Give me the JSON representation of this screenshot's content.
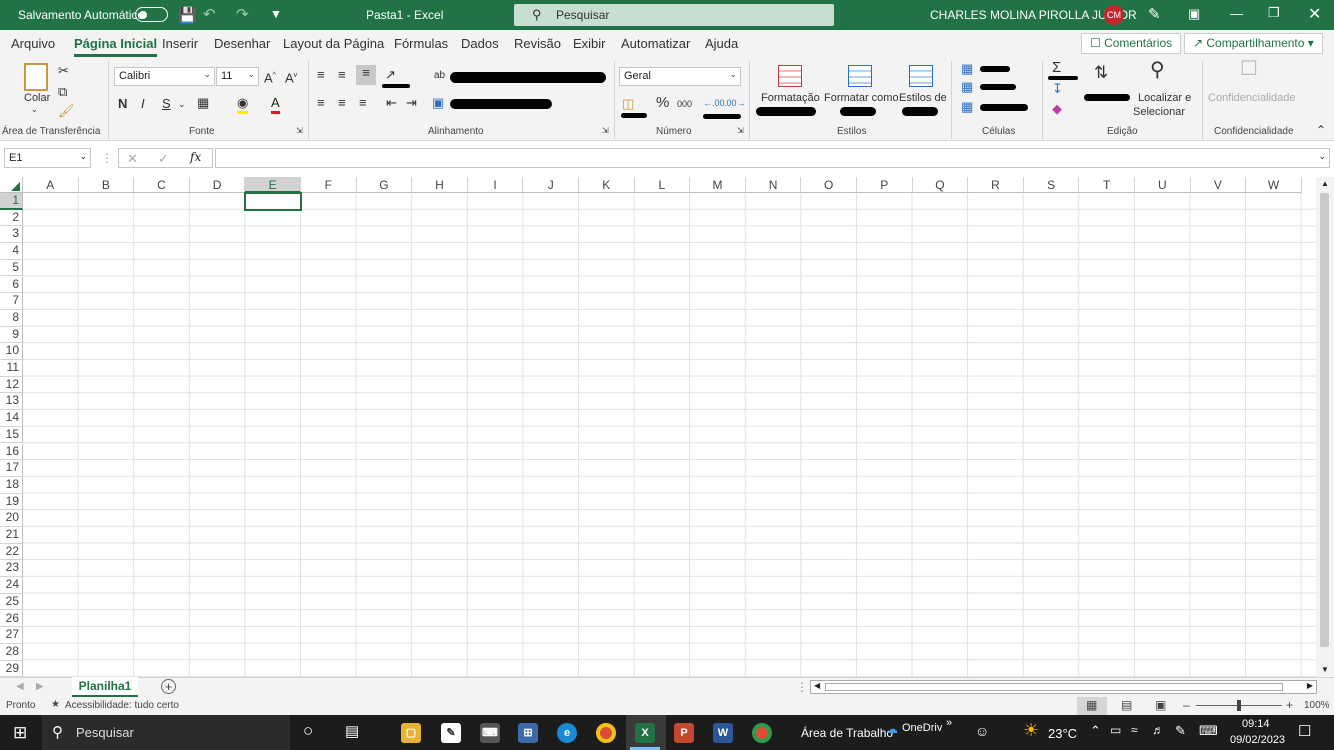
{
  "titlebar": {
    "autosave_label": "Salvamento Automático",
    "doc_title": "Pasta1  -  Excel",
    "search_placeholder": "Pesquisar",
    "user_name": "CHARLES MOLINA PIROLLA JUNIOR",
    "user_initials": "CM"
  },
  "tabs": [
    "Arquivo",
    "Página Inicial",
    "Inserir",
    "Desenhar",
    "Layout da Página",
    "Fórmulas",
    "Dados",
    "Revisão",
    "Exibir",
    "Automatizar",
    "Ajuda"
  ],
  "active_tab": "Página Inicial",
  "top_buttons": {
    "comments": "Comentários",
    "share": "Compartilhamento"
  },
  "ribbon": {
    "clipboard": {
      "paste": "Colar",
      "group": "Área de Transferência"
    },
    "font": {
      "name": "Calibri",
      "size": "11",
      "bold": "N",
      "italic": "I",
      "underline": "S",
      "group": "Fonte"
    },
    "alignment": {
      "group": "Alinhamento"
    },
    "number": {
      "format": "Geral",
      "percent": "%",
      "thousands": "000",
      "group": "Número"
    },
    "styles": {
      "conditional": "Formatação",
      "as_table": "Formatar como",
      "cell_styles": "Estilos de",
      "group": "Estilos"
    },
    "cells": {
      "group": "Células"
    },
    "editing": {
      "find_line1": "Localizar e",
      "find_line2": "Selecionar",
      "group": "Edição"
    },
    "sensitivity": {
      "label": "Confidencialidade",
      "group": "Confidencialidade"
    }
  },
  "formula_bar": {
    "name_box": "E1",
    "fx": "fx",
    "value": ""
  },
  "grid": {
    "columns": [
      "A",
      "B",
      "C",
      "D",
      "E",
      "F",
      "G",
      "H",
      "I",
      "J",
      "K",
      "L",
      "M",
      "N",
      "O",
      "P",
      "Q",
      "R",
      "S",
      "T",
      "U",
      "V",
      "W"
    ],
    "rows": [
      "1",
      "2",
      "3",
      "4",
      "5",
      "6",
      "7",
      "8",
      "9",
      "10",
      "11",
      "12",
      "13",
      "14",
      "15",
      "16",
      "17",
      "18",
      "19",
      "20",
      "21",
      "22",
      "23",
      "24",
      "25",
      "26",
      "27",
      "28",
      "29"
    ],
    "active_cell": "E1"
  },
  "sheets": [
    "Planilha1"
  ],
  "status": {
    "ready": "Pronto",
    "accessibility": "Acessibilidade: tudo certo",
    "zoom": "100%"
  },
  "taskbar": {
    "search": "Pesquisar",
    "desktop": "Área de Trabalho",
    "onedrive": "OneDrive",
    "temperature": "23°C",
    "time": "09:14",
    "date": "09/02/2023"
  },
  "colors": {
    "excel_green": "#217346",
    "avatar_red": "#c4262e"
  }
}
